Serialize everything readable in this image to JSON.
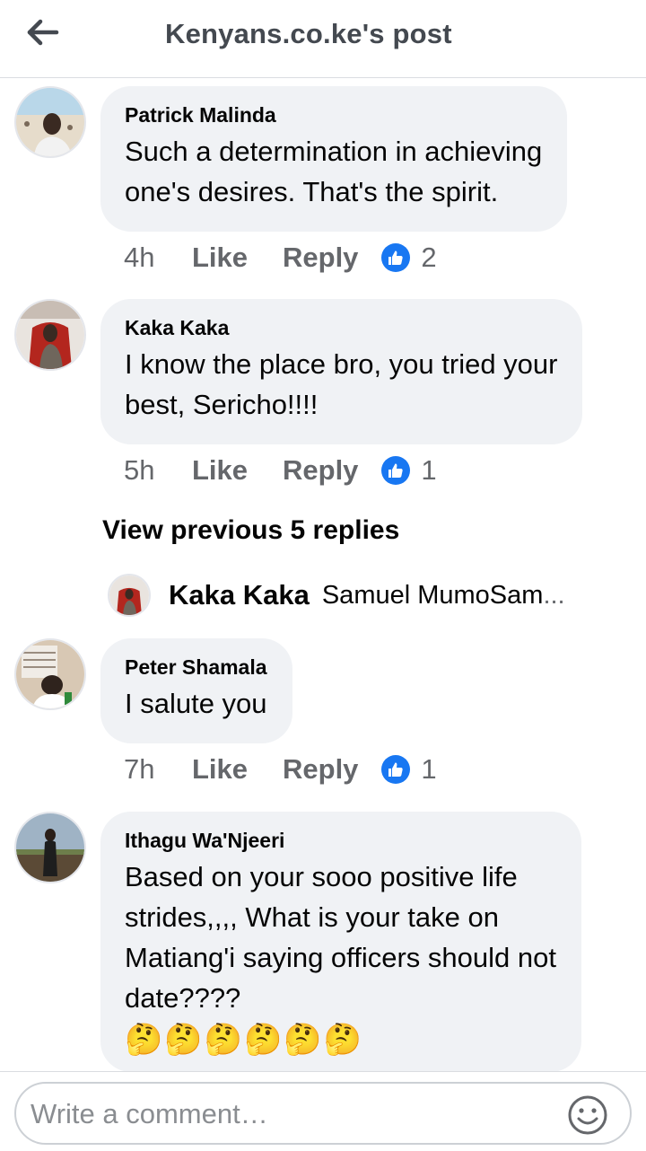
{
  "header": {
    "title": "Kenyans.co.ke's post",
    "back_icon": "arrow-left-icon"
  },
  "colors": {
    "like_blue": "#1877f2",
    "bubble_bg": "#f0f2f5",
    "meta_gray": "#65676b"
  },
  "comments": [
    {
      "author": "Patrick Malinda",
      "lines": [
        "Such a determination in achieving",
        "one's desires. That's the spirit."
      ],
      "time": "4h",
      "like_label": "Like",
      "reply_label": "Reply",
      "likes": "2"
    },
    {
      "author": "Kaka Kaka",
      "lines": [
        "I know the place bro, you tried your",
        "best, Sericho!!!!"
      ],
      "time": "5h",
      "like_label": "Like",
      "reply_label": "Reply",
      "likes": "1"
    },
    {
      "author": "Peter Shamala",
      "lines": [
        "I salute you"
      ],
      "time": "7h",
      "like_label": "Like",
      "reply_label": "Reply",
      "likes": "1"
    },
    {
      "author": "Ithagu Wa'Njeeri",
      "lines": [
        "Based on your sooo positive life",
        "strides,,,, What is your take on",
        "Matiang'i saying officers should not",
        "date????"
      ],
      "emojis": "🤔🤔🤔🤔🤔🤔"
    }
  ],
  "view_previous": "View previous 5 replies",
  "reply_preview": {
    "author": "Kaka Kaka",
    "text": "Samuel MumoSam",
    "ellipsis": "..."
  },
  "composer": {
    "placeholder": "Write a comment…",
    "emoji_icon": "smiley-icon"
  }
}
